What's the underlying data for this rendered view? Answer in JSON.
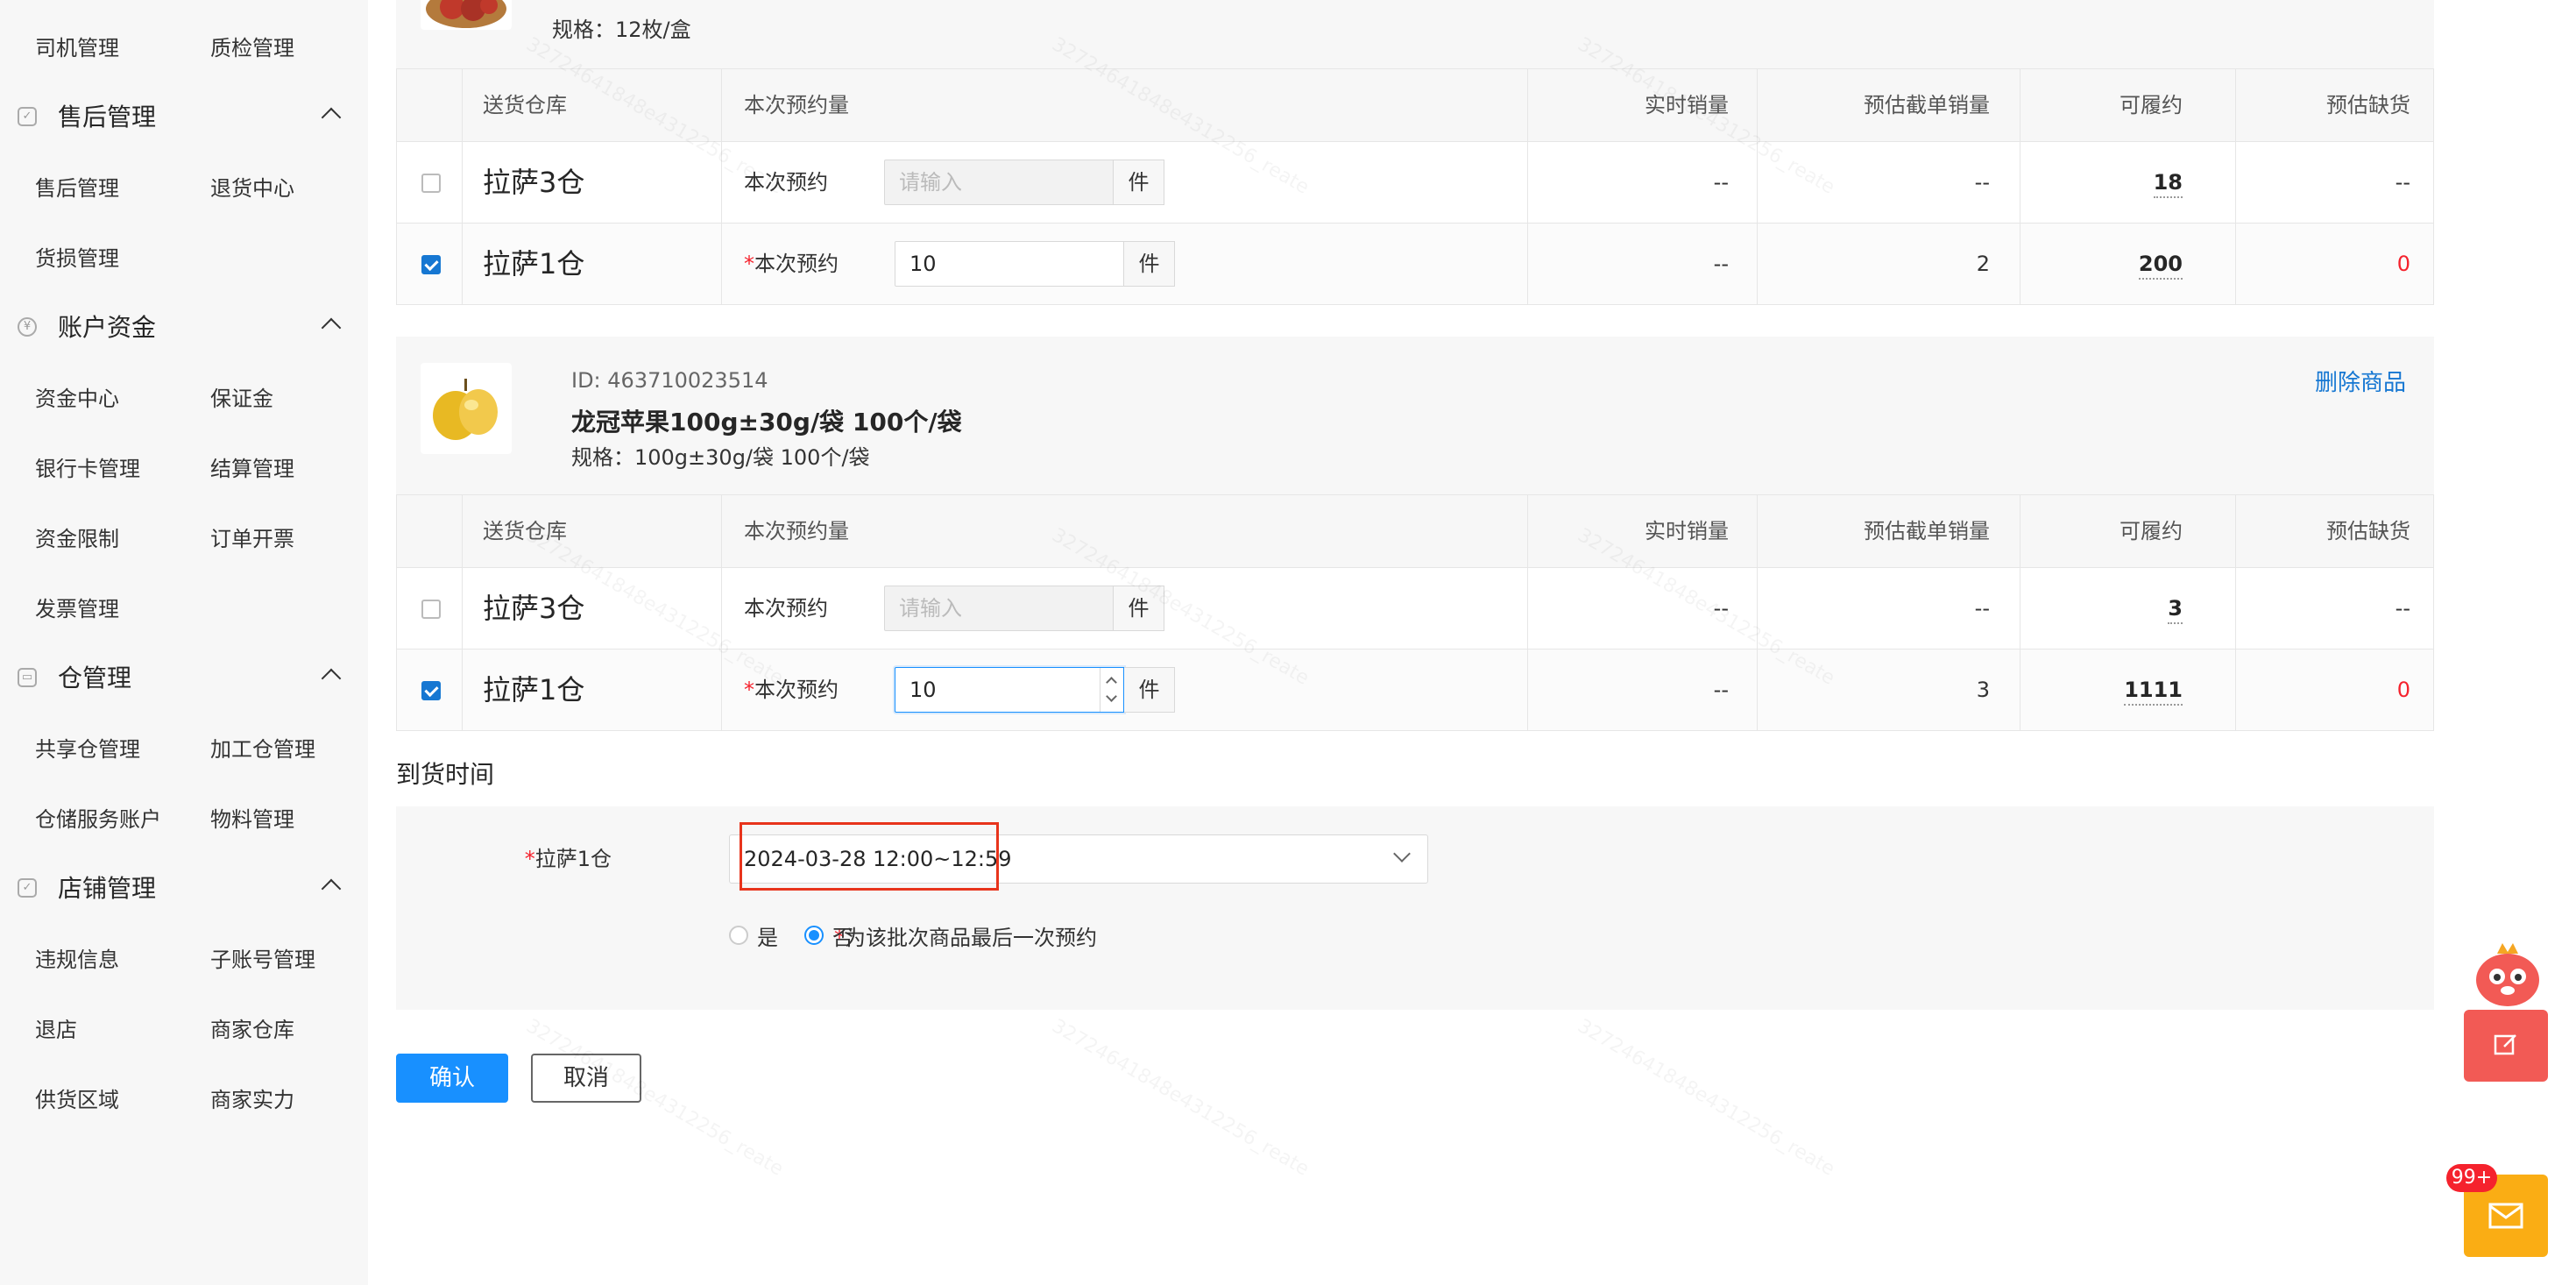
{
  "sidebar": {
    "top_row": [
      "司机管理",
      "质检管理"
    ],
    "groups": [
      {
        "title": "售后管理",
        "icon": "shield-check-icon",
        "items": [
          "售后管理",
          "退货中心",
          "货损管理"
        ]
      },
      {
        "title": "账户资金",
        "icon": "yen-coin-icon",
        "items": [
          "资金中心",
          "保证金",
          "银行卡管理",
          "结算管理",
          "资金限制",
          "订单开票",
          "发票管理"
        ]
      },
      {
        "title": "仓管理",
        "icon": "warehouse-icon",
        "items": [
          "共享仓管理",
          "加工仓管理",
          "仓储服务账户",
          "物料管理"
        ]
      },
      {
        "title": "店铺管理",
        "icon": "shield-check-icon",
        "items": [
          "违规信息",
          "子账号管理",
          "退店",
          "商家仓库",
          "供货区域",
          "商家实力"
        ]
      }
    ]
  },
  "columns": [
    "送货仓库",
    "本次预约量",
    "实时销量",
    "预估截单销量",
    "可履约",
    "预估缺货"
  ],
  "reserve_label": "本次预约",
  "unit_label": "件",
  "placeholder": "请输入",
  "product1": {
    "spec": "规格：12枚/盒",
    "rows": [
      {
        "warehouse": "拉萨3仓",
        "checked": false,
        "value": "",
        "realtime": "--",
        "estimated": "--",
        "fulfill": "18",
        "shortage": "--"
      },
      {
        "warehouse": "拉萨1仓",
        "checked": true,
        "value": "10",
        "realtime": "--",
        "estimated": "2",
        "fulfill": "200",
        "shortage": "0"
      }
    ]
  },
  "product2": {
    "id": "ID: 463710023514",
    "name": "龙冠苹果100g±30g/袋 100个/袋",
    "spec": "规格：100g±30g/袋 100个/袋",
    "delete_label": "删除商品",
    "rows": [
      {
        "warehouse": "拉萨3仓",
        "checked": false,
        "value": "",
        "realtime": "--",
        "estimated": "--",
        "fulfill": "3",
        "shortage": "--"
      },
      {
        "warehouse": "拉萨1仓",
        "checked": true,
        "value": "10",
        "realtime": "--",
        "estimated": "3",
        "fulfill": "1111",
        "shortage": "0"
      }
    ]
  },
  "arrival": {
    "title": "到货时间",
    "warehouse_label": "拉萨1仓",
    "time_value": "2024-03-28 12:00~12:59",
    "last_label": "为该批次商品最后一次预约",
    "yes": "是",
    "no": "否",
    "selected": "否"
  },
  "actions": {
    "confirm": "确认",
    "cancel": "取消"
  },
  "float": {
    "badge": "99+"
  },
  "watermark": "32724641848e4312256_reate",
  "colors": {
    "primary": "#1890ff",
    "danger": "#f5222d",
    "highlight": "#e8341c",
    "float_red": "#f25a55",
    "float_orange": "#faad14"
  }
}
